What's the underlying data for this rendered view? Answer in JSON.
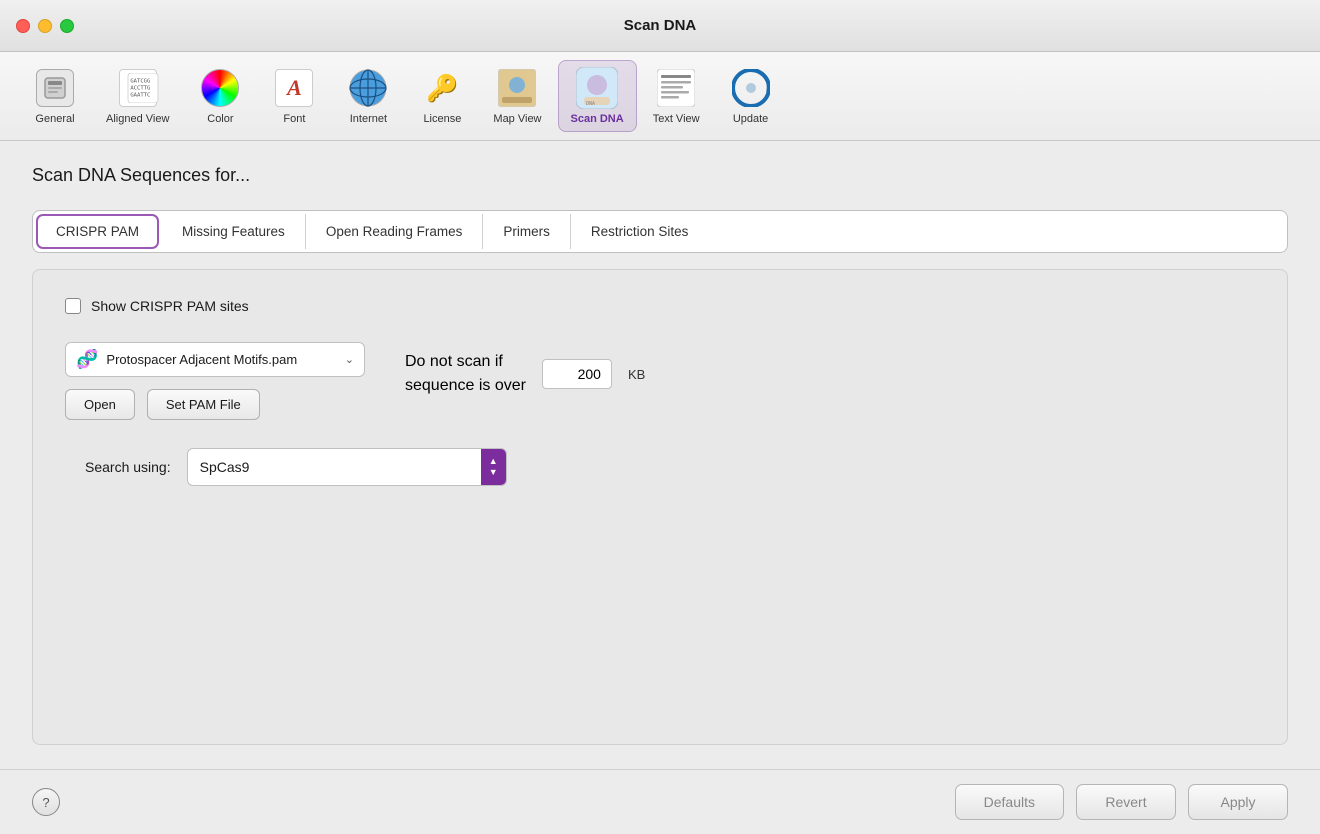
{
  "window": {
    "title": "Scan DNA"
  },
  "toolbar": {
    "items": [
      {
        "id": "general",
        "label": "General",
        "icon": "general-icon"
      },
      {
        "id": "aligned-view",
        "label": "Aligned View",
        "icon": "aligned-view-icon"
      },
      {
        "id": "color",
        "label": "Color",
        "icon": "color-icon"
      },
      {
        "id": "font",
        "label": "Font",
        "icon": "font-icon"
      },
      {
        "id": "internet",
        "label": "Internet",
        "icon": "internet-icon"
      },
      {
        "id": "license",
        "label": "License",
        "icon": "license-icon"
      },
      {
        "id": "map-view",
        "label": "Map View",
        "icon": "map-view-icon"
      },
      {
        "id": "scan-dna",
        "label": "Scan DNA",
        "icon": "scan-dna-icon"
      },
      {
        "id": "text-view",
        "label": "Text View",
        "icon": "text-view-icon"
      },
      {
        "id": "update",
        "label": "Update",
        "icon": "update-icon"
      }
    ]
  },
  "main": {
    "section_title": "Scan DNA Sequences for...",
    "tabs": [
      {
        "id": "crispr-pam",
        "label": "CRISPR PAM",
        "active": true
      },
      {
        "id": "missing-features",
        "label": "Missing Features",
        "active": false
      },
      {
        "id": "open-reading-frames",
        "label": "Open Reading Frames",
        "active": false
      },
      {
        "id": "primers",
        "label": "Primers",
        "active": false
      },
      {
        "id": "restriction-sites",
        "label": "Restriction Sites",
        "active": false
      }
    ],
    "crispr_panel": {
      "show_checkbox_label": "Show CRISPR PAM sites",
      "pam_file": "Protospacer Adjacent Motifs.pam",
      "open_button": "Open",
      "set_pam_button": "Set PAM File",
      "scan_limit_label_line1": "Do not scan if",
      "scan_limit_label_line2": "sequence is over",
      "scan_limit_value": "200",
      "scan_limit_unit": "KB",
      "search_label": "Search using:",
      "search_value": "SpCas9"
    }
  },
  "bottom_bar": {
    "defaults_label": "Defaults",
    "revert_label": "Revert",
    "apply_label": "Apply"
  }
}
